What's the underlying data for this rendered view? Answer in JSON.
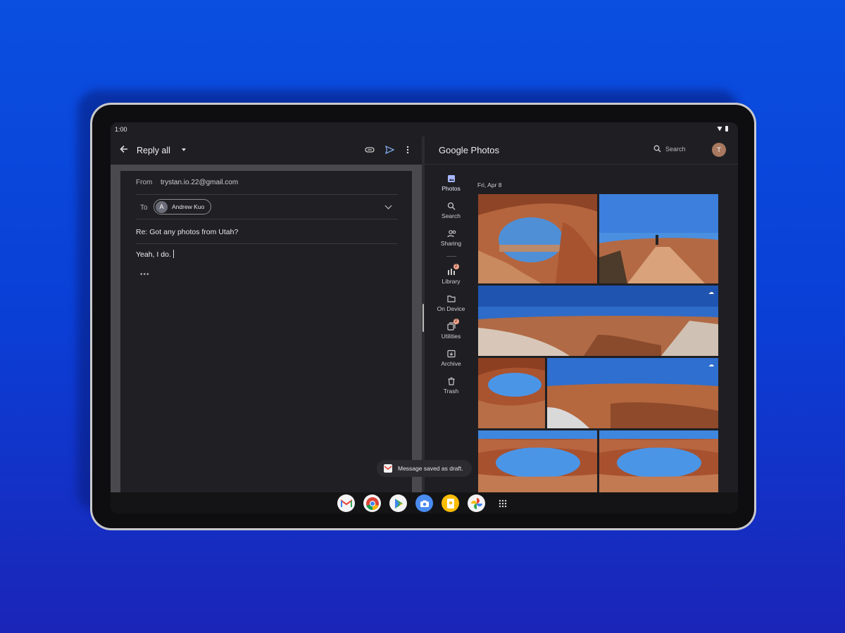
{
  "status_bar": {
    "time": "1:00"
  },
  "gmail": {
    "toolbar": {
      "title": "Reply all"
    },
    "from": {
      "label": "From",
      "value": "trystan.io.22@gmail.com"
    },
    "to": {
      "label": "To",
      "recipient_initial": "A",
      "recipient_name": "Andrew Kuo"
    },
    "subject": "Re: Got any photos from Utah?",
    "body": "Yeah, I do.",
    "quoted_ellipsis": "•••"
  },
  "photos": {
    "app_title": "Google Photos",
    "search_label": "Search",
    "account_initial": "T",
    "nav": [
      {
        "label": "Photos",
        "icon": "photos-icon"
      },
      {
        "label": "Search",
        "icon": "search-icon"
      },
      {
        "label": "Sharing",
        "icon": "sharing-icon"
      },
      {
        "label": "Library",
        "icon": "library-icon",
        "badge": "2"
      },
      {
        "label": "On Device",
        "icon": "folder-icon"
      },
      {
        "label": "Utilities",
        "icon": "utilities-icon",
        "badge": "2"
      },
      {
        "label": "Archive",
        "icon": "archive-icon"
      },
      {
        "label": "Trash",
        "icon": "trash-icon"
      }
    ],
    "date_header": "Fri, Apr 8"
  },
  "toast": {
    "message": "Message saved as draft."
  },
  "dock": {
    "apps": [
      "gmail-icon",
      "chrome-icon",
      "play-store-icon",
      "camera-icon",
      "keep-icon",
      "photos-app-icon",
      "app-drawer-icon"
    ]
  }
}
